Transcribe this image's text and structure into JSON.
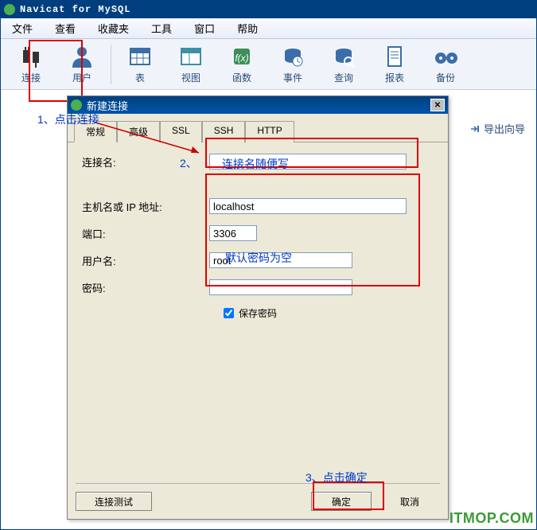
{
  "window": {
    "title": "Navicat for MySQL"
  },
  "menu": {
    "file": "文件",
    "view": "查看",
    "favorites": "收藏夹",
    "tools": "工具",
    "window": "窗口",
    "help": "帮助"
  },
  "toolbar": {
    "connect": "连接",
    "users": "用户",
    "table": "表",
    "view": "视图",
    "function": "函数",
    "event": "事件",
    "query": "查询",
    "report": "报表",
    "backup": "备份"
  },
  "sidebar": {
    "export_wizard": "导出向导"
  },
  "dialog": {
    "title": "新建连接",
    "tabs": {
      "general": "常规",
      "advanced": "高级",
      "ssl": "SSL",
      "ssh": "SSH",
      "http": "HTTP"
    },
    "labels": {
      "name": "连接名:",
      "host": "主机名或 IP 地址:",
      "port": "端口:",
      "user": "用户名:",
      "pass": "密码:"
    },
    "values": {
      "name": "",
      "host": "localhost",
      "port": "3306",
      "user": "root",
      "pass": ""
    },
    "save_pass": "保存密码",
    "buttons": {
      "test": "连接测试",
      "ok": "确定",
      "cancel": "取消"
    }
  },
  "annotations": {
    "step1": "1、点击连接",
    "step2_num": "2、",
    "step2_text": "连接名随便写",
    "step3_text": "默认密码为空",
    "step4": "3、点击确定"
  },
  "watermark": "ITMOP.COM"
}
